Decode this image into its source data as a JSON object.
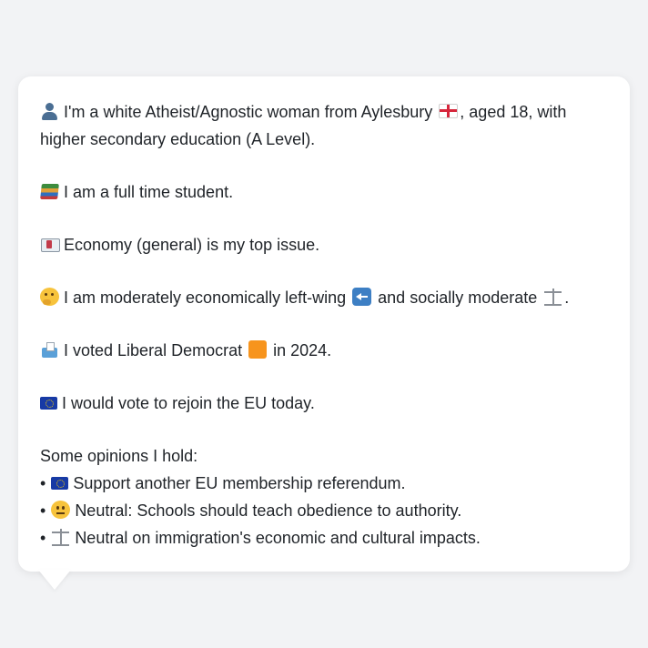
{
  "profile": {
    "identity": {
      "icon": "person-icon",
      "text_before_flag": "I'm a white Atheist/Agnostic woman from Aylesbury",
      "flag_icon": "england-flag-icon",
      "text_after_flag": ", aged 18, with higher secondary education (A Level)."
    },
    "occupation": {
      "icon": "books-icon",
      "text": "I am a full time student."
    },
    "top_issue": {
      "icon": "chart-icon",
      "text": "Economy (general) is my top issue."
    },
    "ideology": {
      "icon": "thinking-face-icon",
      "text_part1": "I am moderately economically left-wing",
      "left_icon": "left-arrow-icon",
      "text_part2": "and socially moderate",
      "moderate_icon": "scales-icon",
      "text_end": "."
    },
    "vote_2024": {
      "icon": "ballot-box-icon",
      "text_before": "I voted Liberal Democrat",
      "party_icon": "orange-square-icon",
      "text_after": "in 2024."
    },
    "eu": {
      "icon": "eu-flag-icon",
      "text": "I would vote to rejoin the EU today."
    },
    "opinions": {
      "heading": "Some opinions I hold:",
      "bullet": "•",
      "items": [
        {
          "icon": "eu-flag-icon",
          "text": "Support another EU membership referendum."
        },
        {
          "icon": "neutral-face-icon",
          "text": "Neutral: Schools should teach obedience to authority."
        },
        {
          "icon": "scales-icon",
          "text": "Neutral on immigration's economic and cultural impacts."
        }
      ]
    }
  },
  "colors": {
    "background": "#f2f3f5",
    "card": "#ffffff",
    "text": "#1f2328",
    "lib_dem_orange": "#f7941d",
    "eu_blue": "#173aa5"
  }
}
